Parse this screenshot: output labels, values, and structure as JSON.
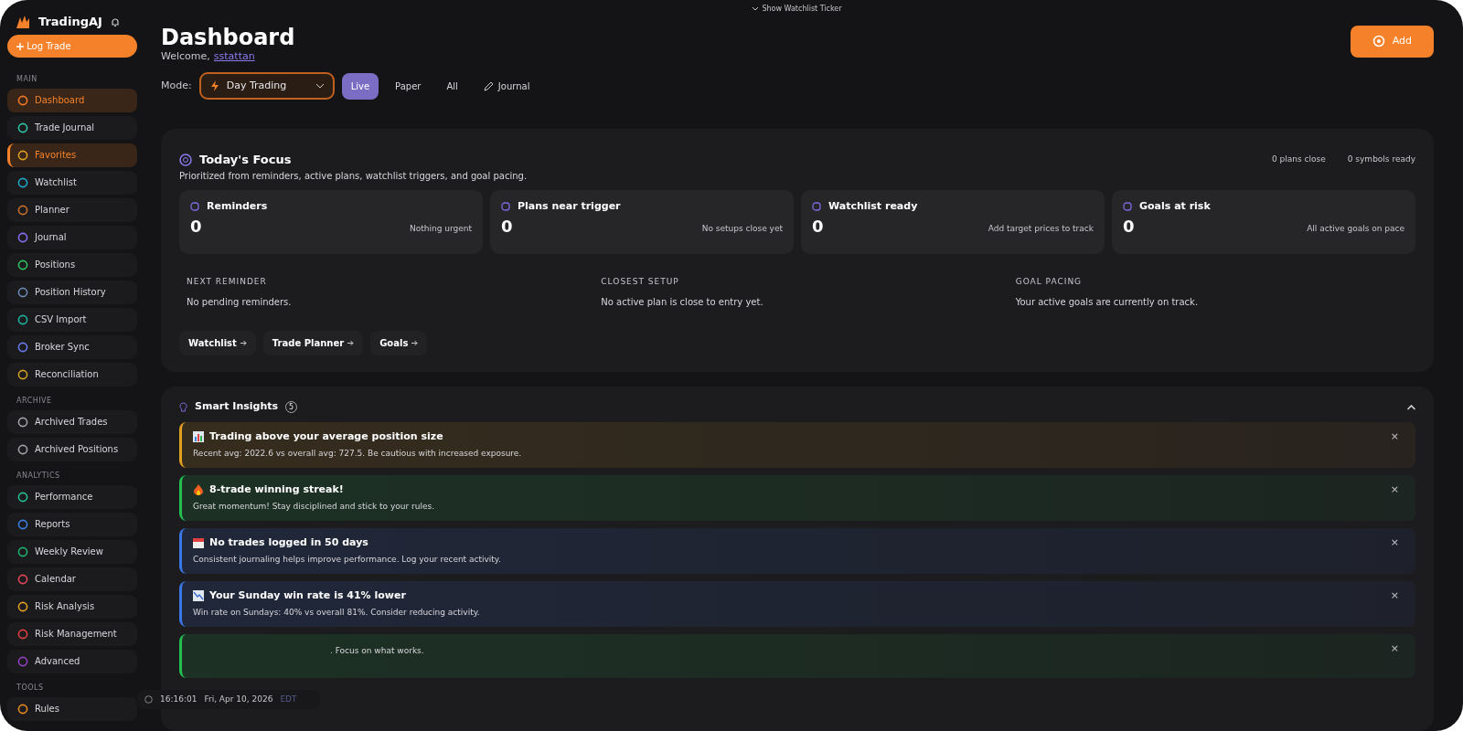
{
  "ticker_toggle": {
    "label": "Show Watchlist Ticker"
  },
  "brand": {
    "name": "TradingAJ"
  },
  "log_button": {
    "label": "Log Trade"
  },
  "sidebar": {
    "sections": [
      {
        "title": "MAIN",
        "items": [
          {
            "label": "Dashboard",
            "color": "#f07a2a",
            "selected": true,
            "highlighted": false
          },
          {
            "label": "Trade Journal",
            "color": "#2ec4a6",
            "selected": false,
            "highlighted": false
          },
          {
            "label": "Favorites",
            "color": "#e0a020",
            "selected": true,
            "highlighted": true
          },
          {
            "label": "Watchlist",
            "color": "#22a8c8",
            "selected": false,
            "highlighted": false
          },
          {
            "label": "Planner",
            "color": "#c8702a",
            "selected": false,
            "highlighted": false
          },
          {
            "label": "Journal",
            "color": "#8a6cf0",
            "selected": false,
            "highlighted": false
          },
          {
            "label": "Positions",
            "color": "#30c060",
            "selected": false,
            "highlighted": false
          },
          {
            "label": "Position History",
            "color": "#6a8ab0",
            "selected": false,
            "highlighted": false
          },
          {
            "label": "CSV Import",
            "color": "#20b0a0",
            "selected": false,
            "highlighted": false
          },
          {
            "label": "Broker Sync",
            "color": "#6a7af0",
            "selected": false,
            "highlighted": false
          },
          {
            "label": "Reconciliation",
            "color": "#d0a020",
            "selected": false,
            "highlighted": false
          }
        ]
      },
      {
        "title": "ARCHIVE",
        "items": [
          {
            "label": "Archived Trades",
            "color": "#a0a0a8",
            "selected": false,
            "highlighted": false
          },
          {
            "label": "Archived Positions",
            "color": "#a0a0a8",
            "selected": false,
            "highlighted": false
          }
        ]
      },
      {
        "title": "ANALYTICS",
        "items": [
          {
            "label": "Performance",
            "color": "#20c090",
            "selected": false,
            "highlighted": false
          },
          {
            "label": "Reports",
            "color": "#3a80e0",
            "selected": false,
            "highlighted": false
          },
          {
            "label": "Weekly Review",
            "color": "#20b070",
            "selected": false,
            "highlighted": false
          },
          {
            "label": "Calendar",
            "color": "#e04858",
            "selected": false,
            "highlighted": false
          },
          {
            "label": "Risk Analysis",
            "color": "#e0a020",
            "selected": false,
            "highlighted": false
          },
          {
            "label": "Risk Management",
            "color": "#e04040",
            "selected": false,
            "highlighted": false
          },
          {
            "label": "Advanced",
            "color": "#9040c0",
            "selected": false,
            "highlighted": false
          }
        ]
      },
      {
        "title": "TOOLS",
        "items": [
          {
            "label": "Rules",
            "color": "#e08a20",
            "selected": false,
            "highlighted": false
          }
        ]
      }
    ]
  },
  "header": {
    "title": "Dashboard",
    "welcome": "Welcome,",
    "user": "sstattan"
  },
  "add_button": {
    "label": "Add"
  },
  "mode": {
    "label": "Mode:",
    "value": "Day Trading",
    "options": [
      {
        "label": "Live",
        "selected": true
      },
      {
        "label": "Paper",
        "selected": false
      },
      {
        "label": "All",
        "selected": false
      }
    ],
    "journal": "Journal"
  },
  "focus": {
    "title": "Today's Focus",
    "subtitle": "Prioritized from reminders, active plans, watchlist triggers, and goal pacing.",
    "counters": [
      "0 plans close",
      "0 symbols ready"
    ],
    "stats": [
      {
        "label": "Reminders",
        "value": "0",
        "note": "Nothing urgent"
      },
      {
        "label": "Plans near trigger",
        "value": "0",
        "note": "No setups close yet"
      },
      {
        "label": "Watchlist ready",
        "value": "0",
        "note": "Add target prices to track"
      },
      {
        "label": "Goals at risk",
        "value": "0",
        "note": "All active goals on pace"
      }
    ],
    "details": [
      {
        "heading": "NEXT REMINDER",
        "text": "No pending reminders."
      },
      {
        "heading": "CLOSEST SETUP",
        "text": "No active plan is close to entry yet."
      },
      {
        "heading": "GOAL PACING",
        "text": "Your active goals are currently on track."
      }
    ],
    "links": [
      "Watchlist",
      "Trade Planner",
      "Goals"
    ]
  },
  "insights": {
    "title": "Smart Insights",
    "count": "5",
    "items": [
      {
        "kind": "chart",
        "color": "#e0a020",
        "title": "Trading above your average position size",
        "text": "Recent avg: 2022.6 vs overall avg: 727.5. Be cautious with increased exposure.",
        "dismiss": "×"
      },
      {
        "kind": "flame",
        "color": "#22c050",
        "title": "8-trade winning streak!",
        "text": "Great momentum! Stay disciplined and stick to your rules.",
        "dismiss": "×"
      },
      {
        "kind": "calendar",
        "color": "#3a78e8",
        "title": "No trades logged in 50 days",
        "text": "Consistent journaling helps improve performance. Log your recent activity.",
        "dismiss": "×"
      },
      {
        "kind": "trend",
        "color": "#3a78e8",
        "title": "Your Sunday win rate is 41% lower",
        "text": "Win rate on Sundays: 40% vs overall 81%. Consider reducing activity.",
        "dismiss": "×"
      },
      {
        "color": "#22c050",
        "text": ". Focus on what works.",
        "dismiss": "×"
      }
    ]
  },
  "clock": {
    "time": "16:16:01",
    "date": "Fri, Apr 10, 2026",
    "zone": "EDT"
  }
}
